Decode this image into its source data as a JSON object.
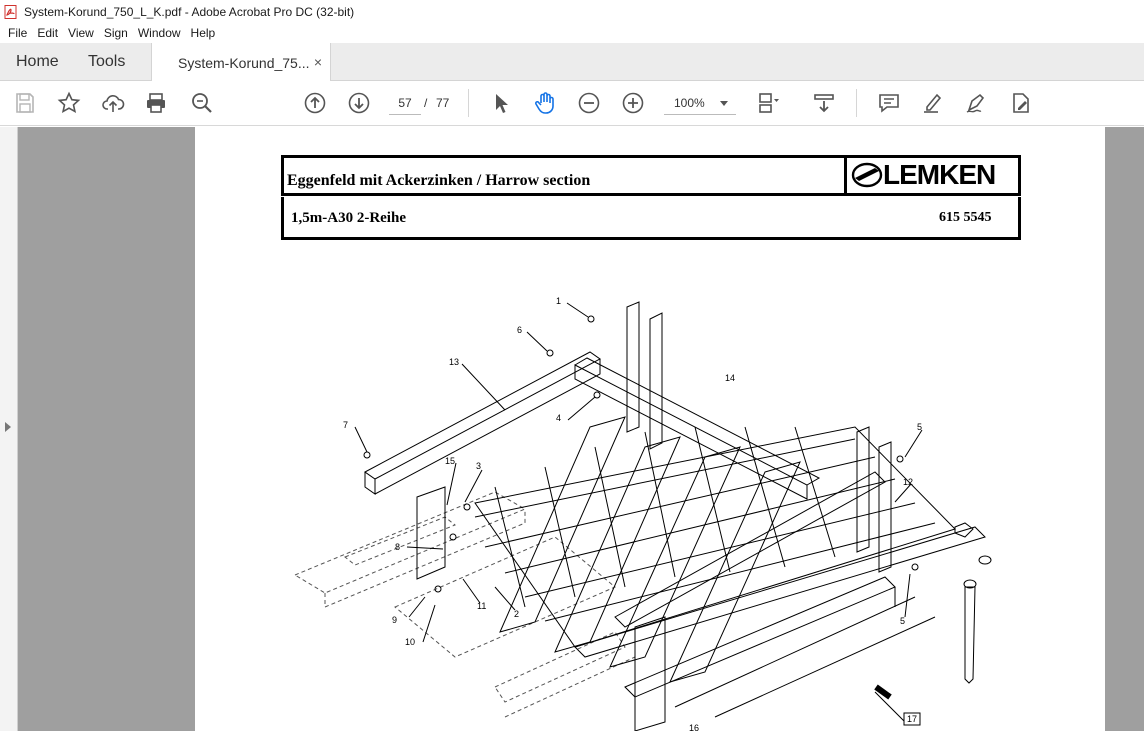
{
  "window": {
    "title": "System-Korund_750_L_K.pdf - Adobe Acrobat Pro DC (32-bit)",
    "app_icon": "acrobat-pdf-icon"
  },
  "menu": [
    "File",
    "Edit",
    "View",
    "Sign",
    "Window",
    "Help"
  ],
  "tabs": {
    "home": "Home",
    "tools": "Tools",
    "document": "System-Korund_75...",
    "close_symbol": "×"
  },
  "toolbar": {
    "page_current": "57",
    "page_separator": "/",
    "page_total": "77",
    "zoom": "100%",
    "icons": [
      "save-icon",
      "bookmark-star-icon",
      "upload-cloud-icon",
      "print-icon",
      "zoom-search-icon",
      "previous-page-icon",
      "next-page-icon",
      "select-cursor-icon",
      "hand-tool-icon",
      "zoom-out-icon",
      "zoom-in-icon",
      "page-display-icon",
      "scroll-mode-icon",
      "comment-icon",
      "highlight-pen-icon",
      "sign-pen-icon",
      "fill-sign-icon"
    ]
  },
  "colors": {
    "accent": "#1473e6",
    "viewer_background": "#9f9f9f",
    "tab_bar": "#ececec"
  },
  "document": {
    "header_title": "Eggenfeld mit Ackerzinken / Harrow section",
    "logo": "LEMKEN",
    "model": "1,5m-A30 2-Reihe",
    "part_number": "615 5545",
    "callouts": [
      "1",
      "6",
      "13",
      "14",
      "7",
      "4",
      "15",
      "3",
      "8",
      "9",
      "10",
      "11",
      "2",
      "5",
      "12",
      "5",
      "17",
      "16"
    ]
  }
}
